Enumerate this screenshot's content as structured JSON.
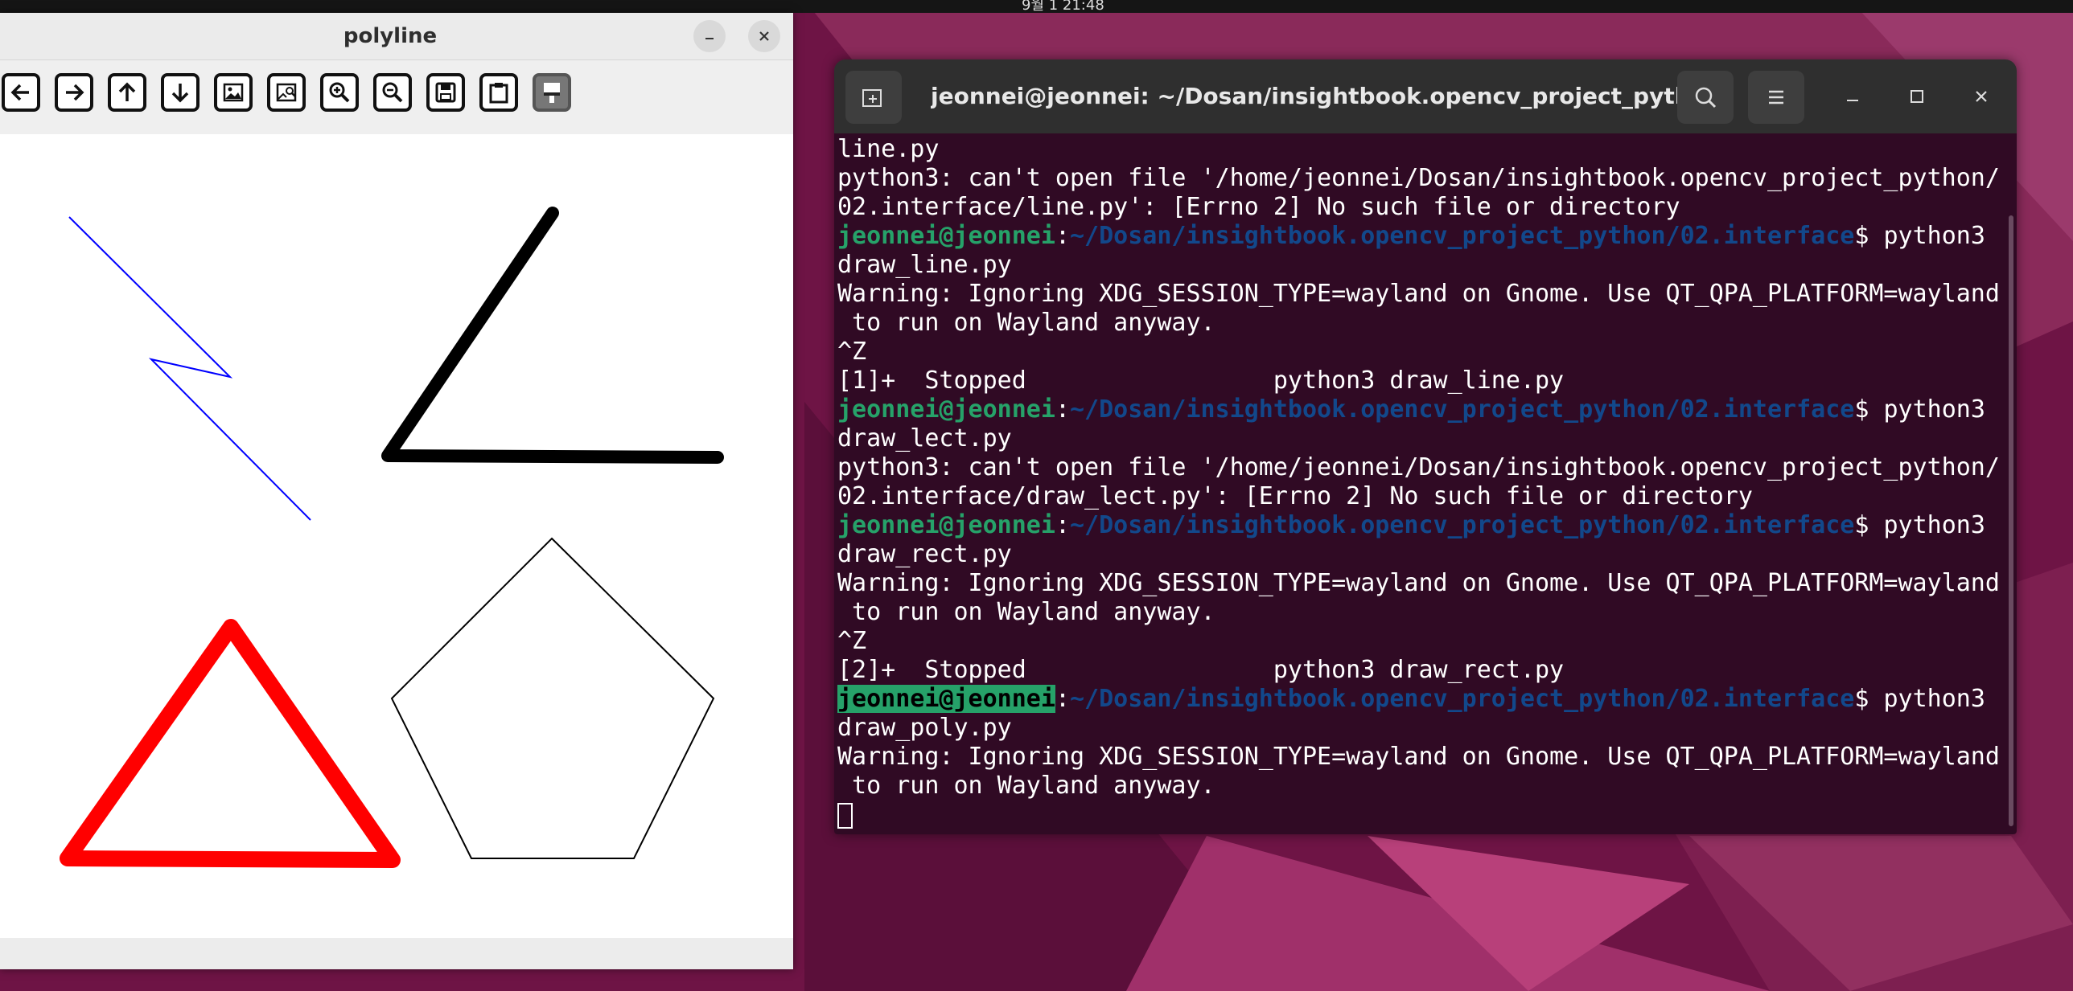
{
  "topbar": {
    "clock": "9월 1 21:48"
  },
  "cv_window": {
    "title": "polyline",
    "toolbar_buttons": [
      {
        "name": "back"
      },
      {
        "name": "forward"
      },
      {
        "name": "pan-up"
      },
      {
        "name": "pan-down"
      },
      {
        "name": "zoom-in-image"
      },
      {
        "name": "zoom-image-region"
      },
      {
        "name": "zoom-in"
      },
      {
        "name": "zoom-out"
      },
      {
        "name": "save"
      },
      {
        "name": "copy-to-clipboard"
      },
      {
        "name": "properties"
      }
    ],
    "canvas_colors": {
      "thin_line": "#0000ff",
      "thick_line": "#000000",
      "triangle": "#ff0000",
      "pentagon": "#000000"
    }
  },
  "terminal": {
    "title": "jeonnei@jeonnei: ~/Dosan/insightbook.opencv_project_pyth...",
    "prompt_user": "jeonnei@jeonnei",
    "prompt_sep": ":",
    "prompt_path": "~/Dosan/insightbook.opencv_project_python/02.interface",
    "prompt_symbol": "$ python3",
    "lines": [
      {
        "type": "text",
        "text": "line.py"
      },
      {
        "type": "text",
        "text": "python3: can't open file '/home/jeonnei/Dosan/insightbook.opencv_project_python/"
      },
      {
        "type": "text",
        "text": "02.interface/line.py': [Errno 2] No such file or directory"
      },
      {
        "type": "prompt"
      },
      {
        "type": "text",
        "text": "draw_line.py"
      },
      {
        "type": "text",
        "text": "Warning: Ignoring XDG_SESSION_TYPE=wayland on Gnome. Use QT_QPA_PLATFORM=wayland"
      },
      {
        "type": "text",
        "text": " to run on Wayland anyway."
      },
      {
        "type": "text",
        "text": "^Z"
      },
      {
        "type": "text",
        "text": "[1]+  Stopped                 python3 draw_line.py"
      },
      {
        "type": "prompt"
      },
      {
        "type": "text",
        "text": "draw_lect.py"
      },
      {
        "type": "text",
        "text": "python3: can't open file '/home/jeonnei/Dosan/insightbook.opencv_project_python/"
      },
      {
        "type": "text",
        "text": "02.interface/draw_lect.py': [Errno 2] No such file or directory"
      },
      {
        "type": "prompt"
      },
      {
        "type": "text",
        "text": "draw_rect.py"
      },
      {
        "type": "text",
        "text": "Warning: Ignoring XDG_SESSION_TYPE=wayland on Gnome. Use QT_QPA_PLATFORM=wayland"
      },
      {
        "type": "text",
        "text": " to run on Wayland anyway."
      },
      {
        "type": "text",
        "text": "^Z"
      },
      {
        "type": "text",
        "text": "[2]+  Stopped                 python3 draw_rect.py"
      },
      {
        "type": "prompt",
        "highlight": true
      },
      {
        "type": "text",
        "text": "draw_poly.py"
      },
      {
        "type": "text",
        "text": "Warning: Ignoring XDG_SESSION_TYPE=wayland on Gnome. Use QT_QPA_PLATFORM=wayland"
      },
      {
        "type": "text",
        "text": " to run on Wayland anyway."
      },
      {
        "type": "cursor"
      }
    ]
  }
}
